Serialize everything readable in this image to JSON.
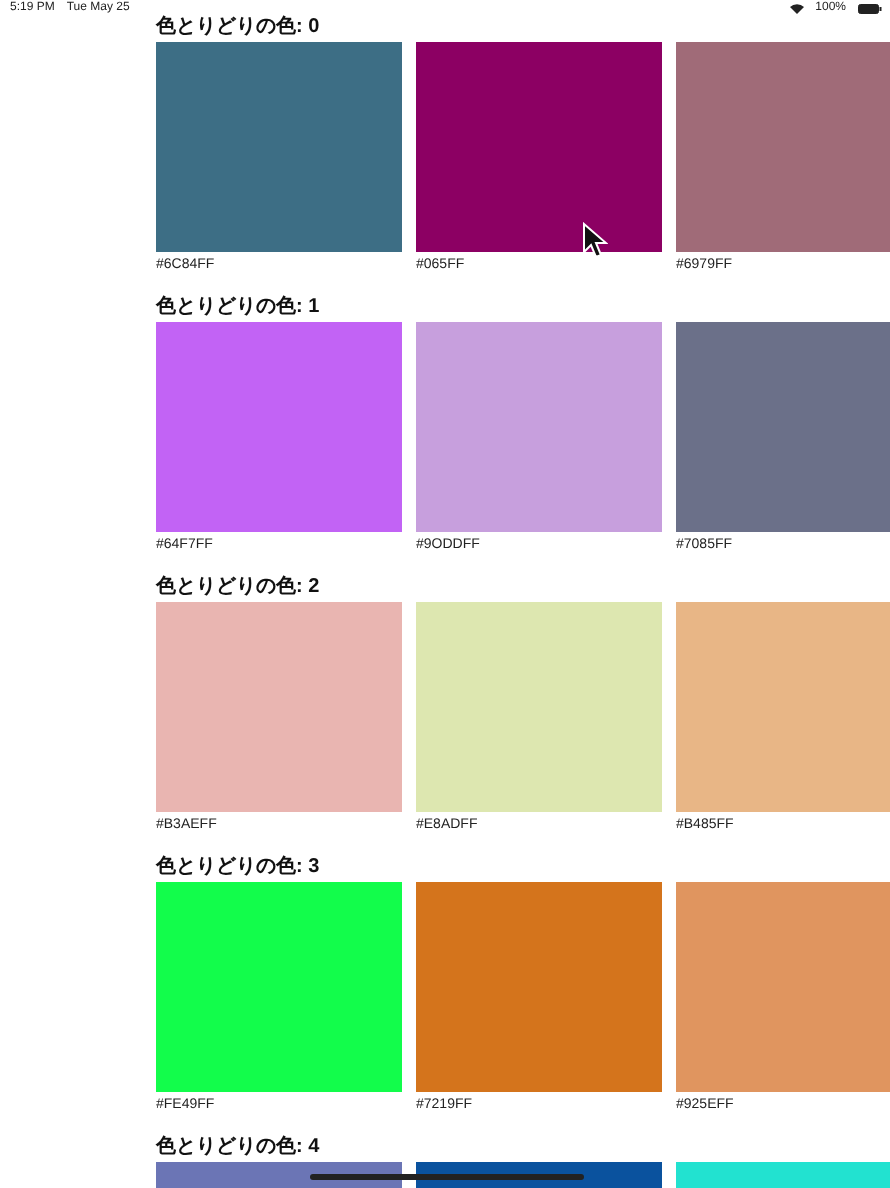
{
  "status_bar": {
    "time": "5:19 PM",
    "date": "Tue May 25",
    "battery": "100%"
  },
  "sections": [
    {
      "title": "色とりどりの色: 0",
      "swatches": [
        {
          "label": "#6C84FF",
          "color": "#3d6e85"
        },
        {
          "label": "#065FF",
          "color": "#8c0063"
        },
        {
          "label": "#6979FF",
          "color": "#a06b78"
        }
      ]
    },
    {
      "title": "色とりどりの色: 1",
      "swatches": [
        {
          "label": "#64F7FF",
          "color": "#c263f5"
        },
        {
          "label": "#9ODDFF",
          "color": "#c79fdd"
        },
        {
          "label": "#7085FF",
          "color": "#6b7089"
        }
      ]
    },
    {
      "title": "色とりどりの色: 2",
      "swatches": [
        {
          "label": "#B3AEFF",
          "color": "#e9b5b1"
        },
        {
          "label": "#E8ADFF",
          "color": "#dde7b0"
        },
        {
          "label": "#B485FF",
          "color": "#e8b686"
        }
      ]
    },
    {
      "title": "色とりどりの色: 3",
      "swatches": [
        {
          "label": "#FE49FF",
          "color": "#12fd4b"
        },
        {
          "label": "#7219FF",
          "color": "#d4741c"
        },
        {
          "label": "#925EFF",
          "color": "#e0955f"
        }
      ]
    },
    {
      "title": "色とりどりの色: 4",
      "swatches": [
        {
          "color": "#6b75b5"
        },
        {
          "color": "#0a529e"
        },
        {
          "color": "#22e2d0"
        }
      ]
    }
  ]
}
